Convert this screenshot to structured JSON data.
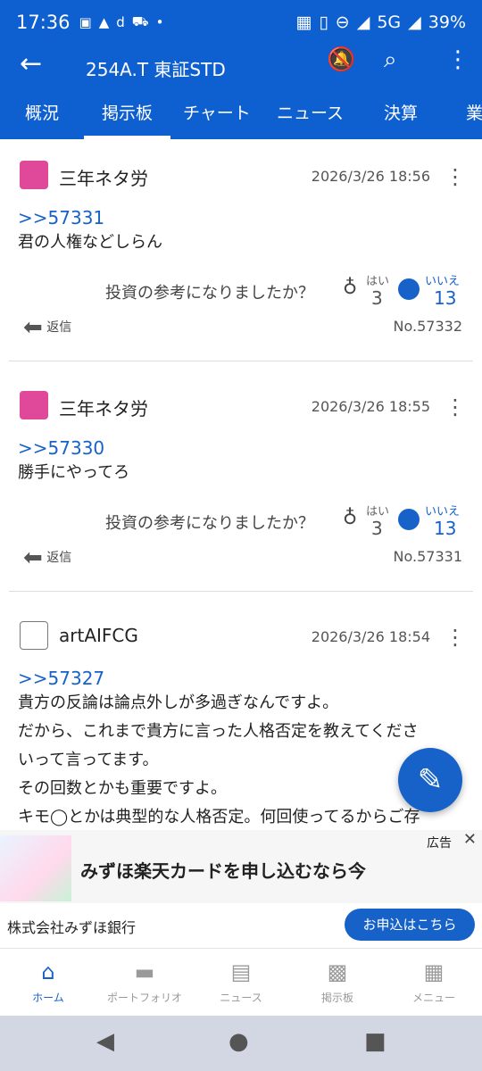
{
  "status_bar": {
    "time": "17:36",
    "left_icons": [
      "line-icon",
      "warning-icon",
      "d-icon",
      "cart-icon",
      "dot-icon"
    ],
    "network": "5G",
    "battery": "39%"
  },
  "app_bar": {
    "ticker": "254A.T 東証STD"
  },
  "tabs": [
    {
      "label": "概況"
    },
    {
      "label": "掲示板"
    },
    {
      "label": "チャート"
    },
    {
      "label": "ニュース"
    },
    {
      "label": "決算"
    },
    {
      "label": "業"
    }
  ],
  "posts": [
    {
      "user": "三年ネタ労",
      "date": "2026/3/26 18:56",
      "ref": ">>57331",
      "body": [
        "君の人権などしらん"
      ],
      "question": "投資の参考になりましたか？",
      "yes_label": "はい",
      "yes_count": "3",
      "no_label": "いいえ",
      "no_count": "13",
      "reply_label": "返信",
      "post_no": "No.57332"
    },
    {
      "user": "三年ネタ労",
      "date": "2026/3/26 18:55",
      "ref": ">>57330",
      "body": [
        "勝手にやってろ"
      ],
      "question": "投資の参考になりましたか？",
      "yes_label": "はい",
      "yes_count": "3",
      "no_label": "いいえ",
      "no_count": "13",
      "reply_label": "返信",
      "post_no": "No.57331"
    },
    {
      "user": "artAIFCG",
      "date": "2026/3/26 18:54",
      "ref": ">>57327",
      "body": [
        "貴方の反論は論点外しが多過ぎなんですよ。",
        "だから、これまで貴方に言った人格否定を教えてくださ",
        "いって言ってます。",
        "その回数とかも重要ですよ。",
        "キモ◯とかは典型的な人格否定。何回使ってるからご存"
      ]
    }
  ],
  "ad": {
    "label": "広告",
    "headline": "みずほ楽天カードを申し込むなら今",
    "advertiser": "株式会社みずほ銀行",
    "cta": "お申込はこちら"
  },
  "bottom_nav": [
    {
      "label": "ホーム",
      "icon": "home-icon"
    },
    {
      "label": "ポートフォリオ",
      "icon": "folder-icon"
    },
    {
      "label": "ニュース",
      "icon": "news-icon"
    },
    {
      "label": "掲示板",
      "icon": "chat-icon"
    },
    {
      "label": "メニュー",
      "icon": "grid-icon"
    }
  ]
}
